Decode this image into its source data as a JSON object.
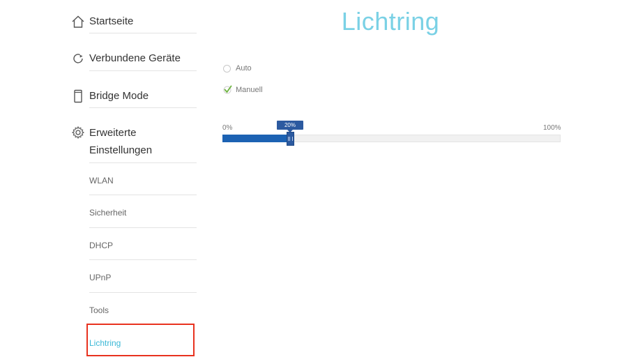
{
  "sidebar": {
    "items": [
      {
        "label": "Startseite",
        "icon": "home-icon"
      },
      {
        "label": "Verbundene Geräte",
        "icon": "devices-icon"
      },
      {
        "label": "Bridge Mode",
        "icon": "bridge-icon"
      },
      {
        "label_line1": "Erweiterte",
        "label_line2": "Einstellungen",
        "icon": "gear-icon"
      }
    ],
    "subitems": [
      {
        "label": "WLAN"
      },
      {
        "label": "Sicherheit"
      },
      {
        "label": "DHCP"
      },
      {
        "label": "UPnP"
      },
      {
        "label": "Tools"
      },
      {
        "label": "Lichtring",
        "active": true
      }
    ]
  },
  "main": {
    "title": "Lichtring",
    "options": [
      {
        "label": "Auto",
        "selected": false
      },
      {
        "label": "Manuell",
        "selected": true
      }
    ],
    "slider": {
      "min_label": "0%",
      "max_label": "100%",
      "value_label": "20%",
      "value_percent": 20
    }
  },
  "colors": {
    "accent": "#7ad1e5",
    "active_link": "#3bb8d6",
    "slider_fill": "#1c62b3",
    "highlight": "#e8321f",
    "check": "#6db33f"
  }
}
